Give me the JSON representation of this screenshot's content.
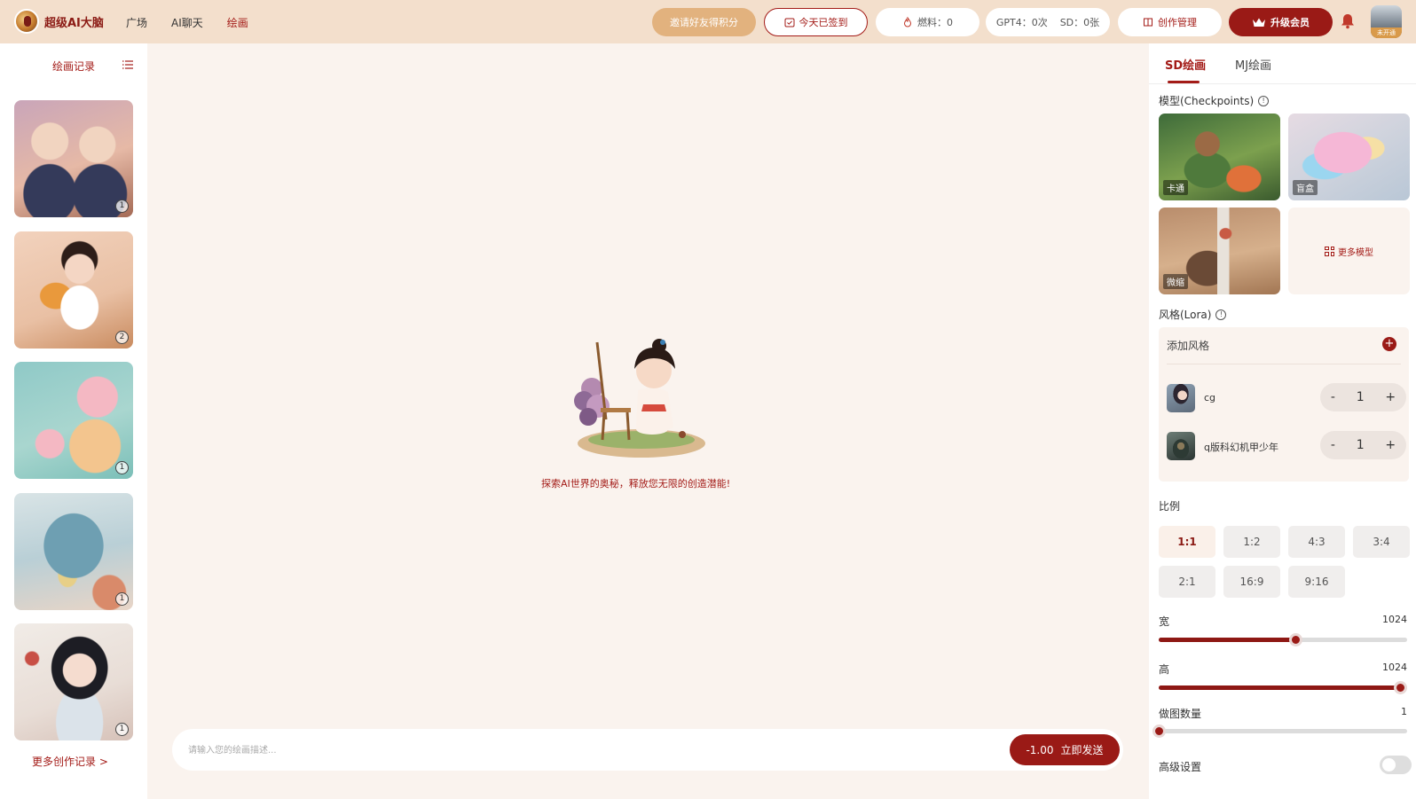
{
  "header": {
    "app_name": "超级AI大脑",
    "nav": [
      "广场",
      "AI聊天",
      "绘画"
    ],
    "invite_label": "邀请好友得积分",
    "signed_label": "今天已签到",
    "fuel_label": "燃料：0",
    "gpt4_quota": "GPT4：0次",
    "sd_quota": "SD：0张",
    "manage_label": "创作管理",
    "vip_label": "升级会员",
    "avatar_tag": "未开通"
  },
  "sidebar": {
    "title": "绘画记录",
    "thumbs": [
      {
        "count": "1"
      },
      {
        "count": "2"
      },
      {
        "count": "1"
      },
      {
        "count": "1"
      },
      {
        "count": "1"
      }
    ],
    "more_label": "更多创作记录 >"
  },
  "main": {
    "empty_text": "探索AI世界的奥秘，释放您无限的创造潜能!",
    "prompt_placeholder": "请输入您的绘画描述...",
    "send_cost": "-1.00",
    "send_label": "立即发送"
  },
  "panel": {
    "tabs": [
      "SD绘画",
      "MJ绘画"
    ],
    "model_label": "模型(Checkpoints)",
    "models": [
      "卡通",
      "盲盒",
      "微缩"
    ],
    "more_models": "更多模型",
    "lora_label": "风格(Lora)",
    "add_style": "添加风格",
    "loras": [
      {
        "name": "cg",
        "value": "1"
      },
      {
        "name": "q版科幻机甲少年",
        "value": "1"
      }
    ],
    "ratio_label": "比例",
    "ratios": [
      "1:1",
      "1:2",
      "4:3",
      "3:4",
      "2:1",
      "16:9",
      "9:16"
    ],
    "selected_ratio": "1:1",
    "width_label": "宽",
    "width_value": "1024",
    "width_fraction": 0.55,
    "height_label": "高",
    "height_value": "1024",
    "height_fraction": 0.97,
    "count_label": "做图数量",
    "count_value": "1",
    "count_fraction": 0.0,
    "advanced_label": "高级设置",
    "advanced_enabled": false
  },
  "colors": {
    "brand": "#9a1a16",
    "accent_text": "#a31b17",
    "header_bg": "#f3dfcc",
    "page_bg": "#faf3ee"
  }
}
